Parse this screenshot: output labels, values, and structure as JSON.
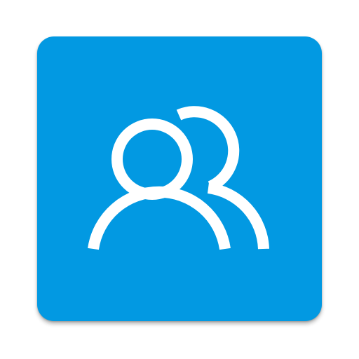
{
  "app_icon": {
    "icon": "people-icon",
    "background_color": "#0299E2",
    "glyph_color": "#FFFFFF"
  }
}
